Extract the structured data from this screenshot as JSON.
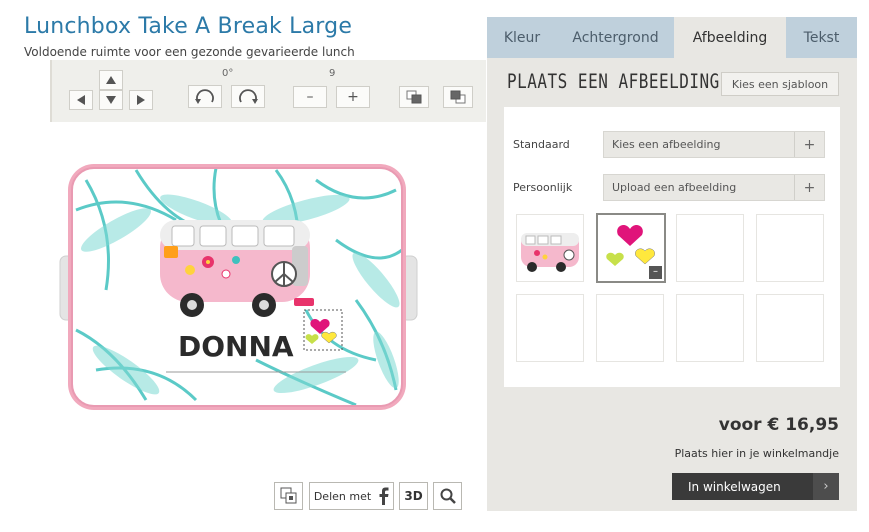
{
  "product": {
    "title": "Lunchbox Take A Break Large",
    "subtitle": "Voldoende ruimte voor een gezonde gevarieerde lunch"
  },
  "toolbar": {
    "rotation_value": "0°",
    "size_value": "9",
    "minus_label": "–",
    "plus_label": "+"
  },
  "preview": {
    "name_text": "DONNA",
    "colors": {
      "box_border": "#f1a9bd",
      "leaf_teal": "#3fc1be",
      "bus_pink": "#f5b8cc",
      "text_dark": "#2b2b2b"
    }
  },
  "bottom_controls": {
    "share_label": "Delen met",
    "share_icon": "facebook-icon",
    "three_d_label": "3D"
  },
  "panel": {
    "tabs": [
      {
        "label": "Kleur",
        "active": false
      },
      {
        "label": "Achtergrond",
        "active": false
      },
      {
        "label": "Afbeelding",
        "active": true
      },
      {
        "label": "Tekst",
        "active": false
      }
    ],
    "section_title": "Plaats een afbeelding",
    "template_button": "Kies een sjabloon",
    "rows": [
      {
        "label": "Standaard",
        "value": "Kies een afbeelding"
      },
      {
        "label": "Persoonlijk",
        "value": "Upload een afbeelding"
      }
    ],
    "plus_label": "+",
    "minus_label": "–",
    "price": "voor € 16,95",
    "cart_hint": "Plaats hier in je winkelmandje",
    "cart_button": "In winkelwagen",
    "cart_chevron": "›"
  }
}
